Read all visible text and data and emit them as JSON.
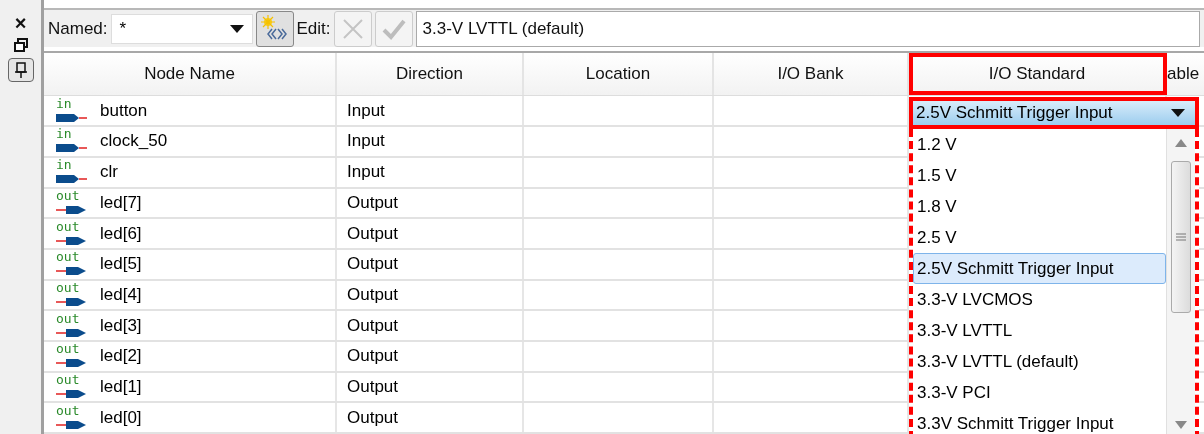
{
  "side_strip": {
    "close": "×"
  },
  "toolbar": {
    "named_label": "Named:",
    "named_value": "*",
    "edit_label": "Edit:",
    "edit_value": "3.3-V LVTTL (default)",
    "cancel_disabled": true,
    "accept_disabled": true
  },
  "table": {
    "columns": [
      "Node Name",
      "Direction",
      "Location",
      "I/O Bank",
      "I/O Standard",
      "able"
    ],
    "rows": [
      {
        "pin": "in",
        "kind": "in",
        "name": "button",
        "direction": "Input"
      },
      {
        "pin": "in",
        "kind": "in",
        "name": "clock_50",
        "direction": "Input"
      },
      {
        "pin": "in",
        "kind": "in",
        "name": "clr",
        "direction": "Input"
      },
      {
        "pin": "out",
        "kind": "out",
        "name": "led[7]",
        "direction": "Output"
      },
      {
        "pin": "out",
        "kind": "out",
        "name": "led[6]",
        "direction": "Output"
      },
      {
        "pin": "out",
        "kind": "out",
        "name": "led[5]",
        "direction": "Output"
      },
      {
        "pin": "out",
        "kind": "out",
        "name": "led[4]",
        "direction": "Output"
      },
      {
        "pin": "out",
        "kind": "out",
        "name": "led[3]",
        "direction": "Output"
      },
      {
        "pin": "out",
        "kind": "out",
        "name": "led[2]",
        "direction": "Output"
      },
      {
        "pin": "out",
        "kind": "out",
        "name": "led[1]",
        "direction": "Output"
      },
      {
        "pin": "out",
        "kind": "out",
        "name": "led[0]",
        "direction": "Output"
      }
    ]
  },
  "dropdown": {
    "value": "2.5V Schmitt Trigger Input",
    "options": [
      {
        "label": "1.2 V",
        "selected": false
      },
      {
        "label": "1.5 V",
        "selected": false
      },
      {
        "label": "1.8 V",
        "selected": false
      },
      {
        "label": "2.5 V",
        "selected": false
      },
      {
        "label": "2.5V Schmitt Trigger Input",
        "selected": true
      },
      {
        "label": "3.3-V LVCMOS",
        "selected": false
      },
      {
        "label": "3.3-V LVTTL",
        "selected": false
      },
      {
        "label": "3.3-V LVTTL (default)",
        "selected": false
      },
      {
        "label": "3.3-V PCI",
        "selected": false
      },
      {
        "label": "3.3V Schmitt Trigger Input",
        "selected": false
      }
    ]
  }
}
